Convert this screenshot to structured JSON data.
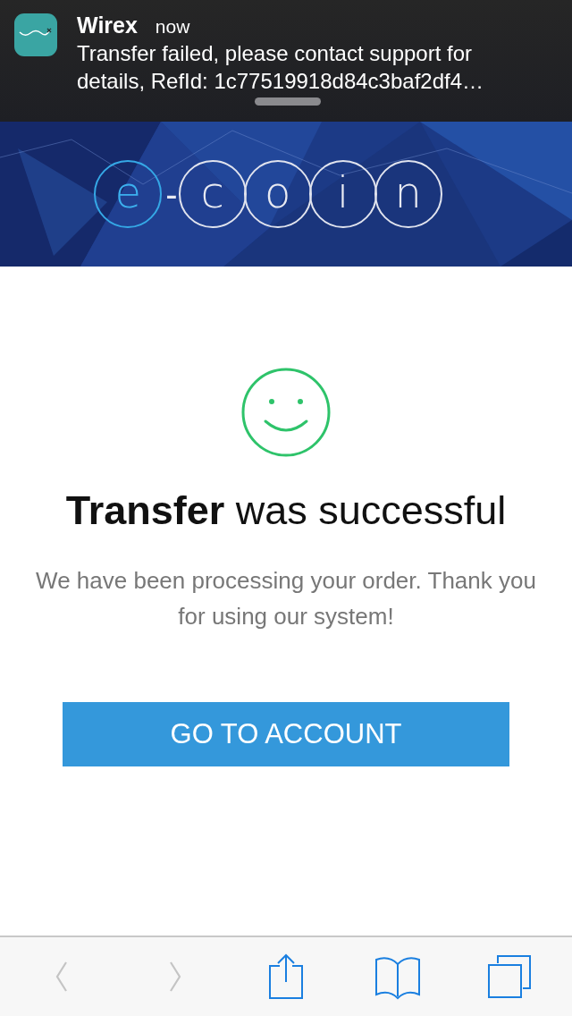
{
  "notification": {
    "app": "Wirex",
    "time": "now",
    "message": "Transfer failed, please contact support for details, RefId: 1c77519918d84c3baf2df4…"
  },
  "banner": {
    "kind": "picture",
    "logo": [
      {
        "char": "e",
        "kind": "accent"
      },
      {
        "char": "-",
        "kind": "separator"
      },
      {
        "char": "c",
        "kind": "letter"
      },
      {
        "char": "o",
        "kind": "letter"
      },
      {
        "char": "i",
        "kind": "letter"
      },
      {
        "char": "n",
        "kind": "letter"
      }
    ]
  },
  "result": {
    "kind": "success",
    "title": "**Transfer** was successful",
    "message": "We have been processing your order. Thank you for using our system!",
    "button": "GO TO ACCOUNT"
  },
  "toolbar": [
    {
      "kind": "back",
      "disabled": true
    },
    {
      "kind": "forward",
      "disabled": true
    },
    {
      "kind": "share",
      "disabled": false
    },
    {
      "kind": "bookmarks",
      "disabled": false
    },
    {
      "kind": "tabs",
      "disabled": false
    }
  ]
}
